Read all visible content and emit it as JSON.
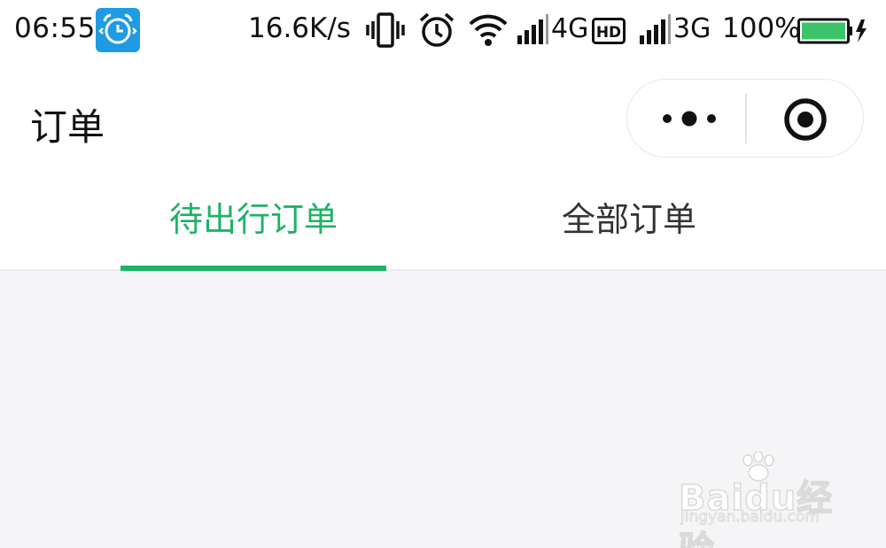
{
  "status_bar": {
    "time": "06:55",
    "app_icon": "alarm-clock-app-icon",
    "net_speed": "16.6K/s",
    "signal1_label": "4G",
    "signal1_badge": "HD",
    "signal2_label": "3G",
    "battery_percent": "100%",
    "battery_color": "#3cc46a"
  },
  "header": {
    "title": "订单",
    "menu_icon": "more-dots-icon",
    "close_icon": "target-close-icon"
  },
  "tabs": [
    {
      "label": "待出行订单",
      "active": true
    },
    {
      "label": "全部订单",
      "active": false
    }
  ],
  "colors": {
    "accent": "#1eb366",
    "background": "#f5f5f7"
  },
  "watermark": {
    "brand": "Baidu经验",
    "url": "jingyan.baidu.com"
  }
}
